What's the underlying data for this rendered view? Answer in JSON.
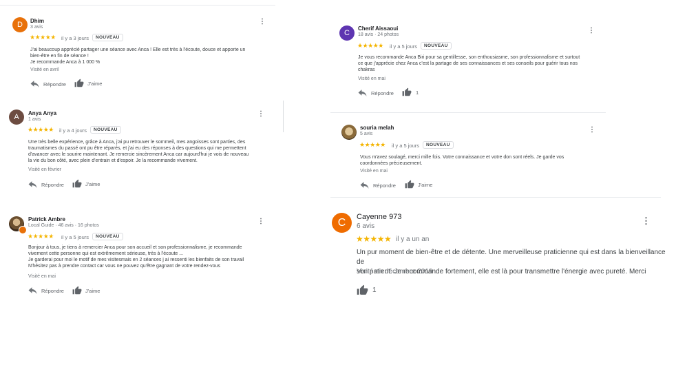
{
  "labels": {
    "reply": "Répondre",
    "like": "J'aime",
    "new_badge": "NOUVEAU",
    "more": "⋮"
  },
  "icons": [
    "reply-icon",
    "thumbs-up-icon",
    "more-vert-icon",
    "local-guide-badge-icon"
  ],
  "colors": {
    "star": "#f4b400",
    "avatar_dhim": "#e8710a",
    "avatar_anya": "#6d4c41",
    "avatar_cherif": "#5e35b1",
    "avatar_cayenne": "#ef6c00"
  },
  "reviews": [
    {
      "name": "Dhim",
      "initial": "D",
      "meta": "3 avis",
      "stars": "★★★★★",
      "ago": "il y a 3 jours",
      "new": true,
      "text": "J'ai beaucoup apprécié partager une séance avec Anca ! Elle est très à l'écoute, douce et apporte un\nbien-être en fin de séance !\nJe recommande Anca à 1 000 %",
      "visited": "Visité en avril",
      "likes": ""
    },
    {
      "name": "Anya Anya",
      "initial": "A",
      "meta": "1 avis",
      "stars": "★★★★★",
      "ago": "il y a 4 jours",
      "new": true,
      "text": "Une très belle expérience, grâce à Anca, j'ai pu retrouver le sommeil, mes angoisses sont parties, des\ntraumatismes du passé ont pu être réparés, et j'ai eu des réponses à des questions qui me permettent\nd'avancer avec le sourire maintenant. Je remercie sincèrement Anca car aujourd'hui je vois de nouveau\nla vie du bon côté, avec plein d'entrain et d'espoir. Je la recommande vivement.",
      "visited": "Visité en février",
      "likes": ""
    },
    {
      "name": "Patrick Ambre",
      "initial": "",
      "meta": "Local Guide · 46 avis · 16 photos",
      "stars": "★★★★★",
      "ago": "il y a 5 jours",
      "new": true,
      "text": "Bonjour à tous, je tiens à remercier Anca pour son accueil et son professionnalisme, je recommande\nvivement cette personne qui est extrêmement sérieuse, très à l'écoute ...\nJe garderai pour moi le motif de mes visitesmais en 2 séances j ai ressenti les bienfaits de son travail\nN'hésitez pas à prendre contact car vous ne pouvez qu'être gagnant de votre rendez-vous",
      "visited": "Visité en mai",
      "likes": ""
    },
    {
      "name": "Cherif Aissaoui",
      "initial": "C",
      "meta": "18 avis · 24 photos",
      "stars": "★★★★★",
      "ago": "il y a 5 jours",
      "new": true,
      "text": "Je vous recommande Anca Biri pour sa gentillesse, son enthousiasme, son professionnalisme et surtout\nce que j'apprécie chez Anca c'est la partage de ses connaissances et ses conseils pour guérir tous nos\nchakras",
      "visited": "Visité en mai",
      "likes": "1"
    },
    {
      "name": "souria melah",
      "initial": "",
      "meta": "5 avis",
      "stars": "★★★★★",
      "ago": "il y a 5 jours",
      "new": true,
      "text": "Vous m'avez soulagé, merci mille fois. Votre connaissance et votre don sont réels. Je garde vos\ncoordonnées précieusement.",
      "visited": "Visité en mai",
      "likes": ""
    },
    {
      "name": "Cayenne 973",
      "initial": "C",
      "meta": "6 avis",
      "stars": "★★★★★",
      "ago": "il y a un an",
      "new": false,
      "text": "Un pur moment de bien-être et de détente. Une merveilleuse praticienne qui est dans la bienveillance de\nson patient. Je recommande fortement, elle est là pour transmettre l'énergie avec pureté. Merci",
      "visited": "Visité en décembre 2019",
      "likes": "1"
    }
  ]
}
